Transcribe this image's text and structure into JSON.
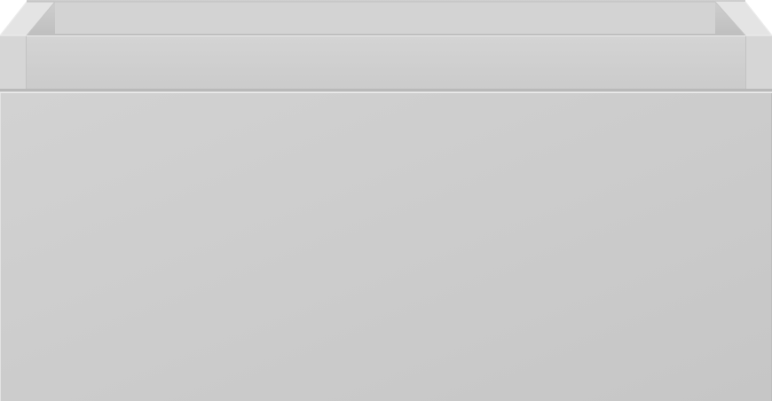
{
  "scene": {
    "subject": "drawer-unit",
    "colors": {
      "background": "#ffffff",
      "inner_back_wall": "#cfcfcf",
      "inner_floor_shadow": "#bdbdbd",
      "rim_top": "#e6e6e6",
      "side_post": "#d6d6d6",
      "side_post_edge": "#c4c4c4",
      "back_rail": "#d4d4d4",
      "front_panel_light": "#d2d2d2",
      "front_panel_dark": "#c6c6c6",
      "panel_edge": "#bcbcbc",
      "highlight": "#ededed",
      "outline": "#a8a8a8"
    }
  }
}
